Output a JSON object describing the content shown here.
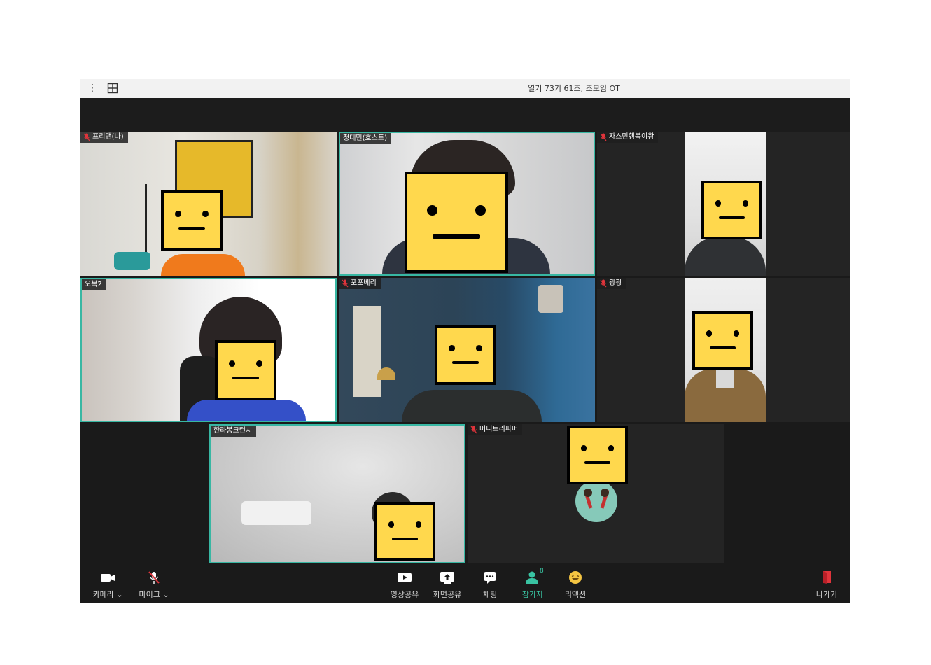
{
  "window": {
    "title": "열기 73기 61조, 조모임 OT"
  },
  "participants": [
    {
      "name": "프리맨(나)",
      "muted": true
    },
    {
      "name": "정대민(호스트)",
      "muted": false
    },
    {
      "name": "자스민행복이왕",
      "muted": true
    },
    {
      "name": "오복2",
      "muted": false
    },
    {
      "name": "포포베리",
      "muted": true
    },
    {
      "name": "광광",
      "muted": true
    },
    {
      "name": "한라봉크런치",
      "muted": false
    },
    {
      "name": "머니트리파머",
      "muted": true
    }
  ],
  "toolbar": {
    "camera": "카메라",
    "mic": "마이크",
    "video_share": "영상공유",
    "screen_share": "화면공유",
    "chat": "채팅",
    "participants": "참가자",
    "participants_count": "8",
    "reaction": "리액션",
    "leave": "나가기"
  },
  "colors": {
    "active_border": "#38b7a3",
    "accent_green": "#39c3a2",
    "leave_red": "#e0343b"
  }
}
